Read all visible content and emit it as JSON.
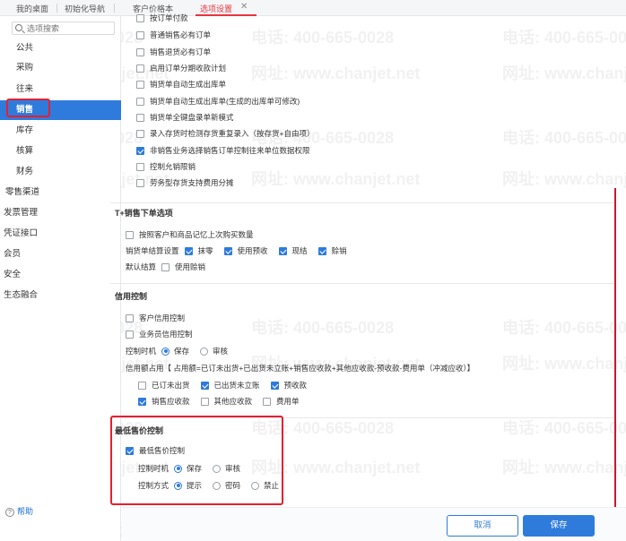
{
  "tabs": [
    {
      "label": "我的桌面",
      "active": false
    },
    {
      "label": "初始化导航",
      "active": false
    },
    {
      "label": "客户价格本",
      "active": false
    },
    {
      "label": "选项设置",
      "active": true
    }
  ],
  "search": {
    "placeholder": "选项搜索"
  },
  "sidebar": {
    "items": [
      {
        "label": "公共"
      },
      {
        "label": "采购"
      },
      {
        "label": "往来"
      },
      {
        "label": "销售",
        "active": true
      },
      {
        "label": "库存"
      },
      {
        "label": "核算"
      },
      {
        "label": "财务"
      },
      {
        "label": "零售渠道"
      },
      {
        "label": "发票管理"
      },
      {
        "label": "凭证接口"
      },
      {
        "label": "会员"
      },
      {
        "label": "安全"
      },
      {
        "label": "生态融合"
      }
    ],
    "help": "帮助"
  },
  "top_options": [
    {
      "label": "按订单付款",
      "checked": false
    },
    {
      "label": "普通销售必有订单",
      "checked": false
    },
    {
      "label": "销售退货必有订单",
      "checked": false
    },
    {
      "label": "启用订单分期收款计划",
      "checked": false
    },
    {
      "label": "销货单自动生成出库单",
      "checked": false
    },
    {
      "label": "销货单自动生成出库单(生成的出库单可修改)",
      "checked": false
    },
    {
      "label": "销货单全键盘录单新模式",
      "checked": false
    },
    {
      "label": "录入存货时检测存货重复录入（按存货+自由项）",
      "checked": false
    },
    {
      "label": "非销售业务选择销售订单控制往来单位数据权限",
      "checked": true
    },
    {
      "label": "控制允销限销",
      "checked": false
    },
    {
      "label": "劳务型存货支持费用分摊",
      "checked": false
    }
  ],
  "t_plus": {
    "title": "T+销售下单选项",
    "remember": {
      "label": "按照客户和商品记忆上次购买数量",
      "checked": false
    },
    "settle_label": "销货单结算设置",
    "settle_options": [
      {
        "label": "抹零",
        "checked": true
      },
      {
        "label": "使用预收",
        "checked": true
      },
      {
        "label": "现结",
        "checked": true
      },
      {
        "label": "赊销",
        "checked": true
      }
    ],
    "default_settle_label": "默认结算",
    "default_settle_option": {
      "label": "使用赊销",
      "checked": false
    }
  },
  "credit": {
    "title": "信用控制",
    "customer": {
      "label": "客户信用控制",
      "checked": false
    },
    "salesman": {
      "label": "业务员信用控制",
      "checked": false
    },
    "timing_label": "控制时机",
    "timing_options": [
      {
        "label": "保存",
        "checked": true
      },
      {
        "label": "审核",
        "checked": false
      }
    ],
    "formula": "信用额占用【 占用额=已订未出货+已出货未立账+销售应收款+其他应收款-预收款-费用单（冲减应收）】",
    "occupy_options": [
      {
        "label": "已订未出货",
        "checked": false
      },
      {
        "label": "已出货未立账",
        "checked": true
      },
      {
        "label": "预收款",
        "checked": true
      },
      {
        "label": "销售应收款",
        "checked": true
      },
      {
        "label": "其他应收款",
        "checked": false
      },
      {
        "label": "费用单",
        "checked": false
      }
    ]
  },
  "min_price": {
    "title": "最低售价控制",
    "enable": {
      "label": "最低售价控制",
      "checked": true
    },
    "timing_label": "控制时机",
    "timing_options": [
      {
        "label": "保存",
        "checked": true
      },
      {
        "label": "审核",
        "checked": false
      }
    ],
    "method_label": "控制方式",
    "method_options": [
      {
        "label": "提示",
        "checked": true
      },
      {
        "label": "密码",
        "checked": false
      },
      {
        "label": "禁止",
        "checked": false
      }
    ]
  },
  "footer": {
    "cancel": "取消",
    "save": "保存"
  },
  "watermarks": {
    "phone": "电话: 400-665-0028",
    "site": "网址: www.chanjet.net"
  },
  "colors": {
    "accent": "#2e7bdc",
    "highlight_red": "#e42030",
    "tab_active": "#e8343e"
  }
}
